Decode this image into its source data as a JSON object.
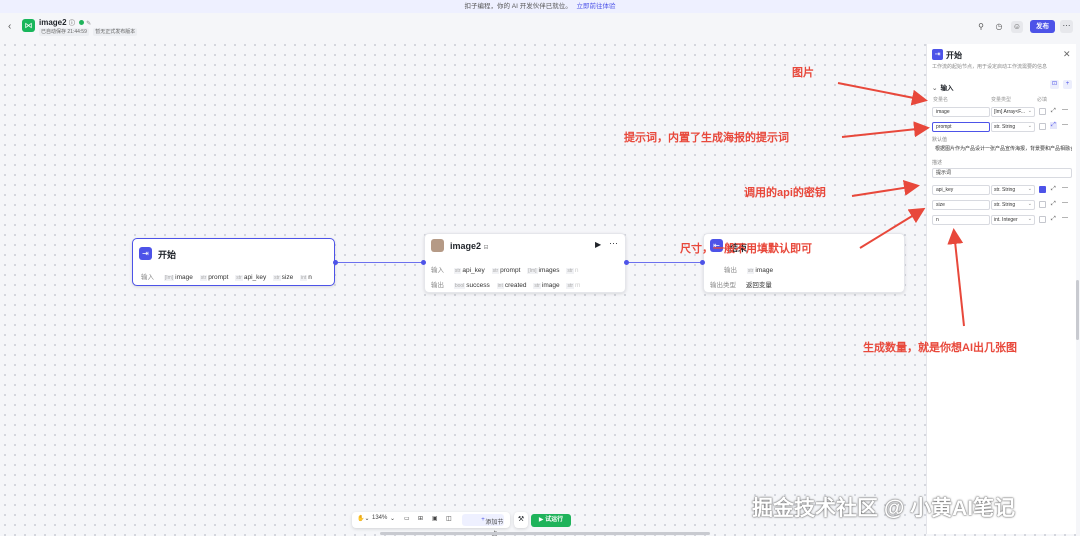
{
  "banner": {
    "text": "扣子编程，你的 AI 开发伙伴已就位。",
    "link": "立即前往体验"
  },
  "header": {
    "app_name": "image2",
    "meta_autosave": "已自动保存 21:44:59",
    "meta_publish": "暂无正式发布版本",
    "publish_label": "发布",
    "more_label": "···"
  },
  "nodes": {
    "start": {
      "title": "开始",
      "input_label": "输入",
      "params": [
        {
          "type": "[Im]",
          "name": "image"
        },
        {
          "type": "str",
          "name": "prompt"
        },
        {
          "type": "str",
          "name": "api_key"
        },
        {
          "type": "str",
          "name": "size"
        },
        {
          "type": "int",
          "name": "n"
        }
      ]
    },
    "image2": {
      "title": "image2",
      "input_label": "输入",
      "output_label": "输出",
      "inputs": [
        {
          "type": "str",
          "name": "api_key"
        },
        {
          "type": "str",
          "name": "prompt"
        },
        {
          "type": "[Im]",
          "name": "images"
        },
        {
          "type": "str",
          "name": "n"
        }
      ],
      "outputs": [
        {
          "type": "bool",
          "name": "success"
        },
        {
          "type": "int",
          "name": "created"
        },
        {
          "type": "str",
          "name": "image"
        },
        {
          "type": "str",
          "name": "m"
        }
      ]
    },
    "end": {
      "title": "结束",
      "output_label": "输出",
      "output_var": "image",
      "output_type_label": "输出类型",
      "output_type_value": "返回变量"
    }
  },
  "panel": {
    "title": "开始",
    "description": "工作流的起始节点，用于设定启动工作流需要的信息",
    "section": "输入",
    "col_name": "变量名",
    "col_type": "变量类型",
    "col_required": "必填",
    "vars": [
      {
        "name": "image",
        "type": "[Im] Array<F...",
        "required": false
      },
      {
        "name": "prompt",
        "type": "str. String",
        "required": false
      },
      {
        "name": "api_key",
        "type": "str. String",
        "required": true
      },
      {
        "name": "size",
        "type": "str. String",
        "required": false
      },
      {
        "name": "n",
        "type": "int. Integer",
        "required": false
      }
    ],
    "default_label": "默认值",
    "default_value": "根据图片作为产品设计一张产品宣传海报，背景要和产品相融合",
    "desc_label": "描述",
    "desc_value": "提示词"
  },
  "annotations": {
    "image": "图片",
    "prompt": "提示词，内置了生成海报的提示词",
    "api_key": "调用的api的密钥",
    "size": "尺寸，一般不用填默认即可",
    "n": "生成数量，就是你想AI出几张图"
  },
  "toolbar": {
    "zoom": "134%",
    "add_node": "添加节点",
    "run": "试运行"
  },
  "watermark": "掘金技术社区 @ 小黄AI笔记",
  "colors": {
    "accent": "#4d53e8",
    "success": "#1fb35b",
    "annotation": "#e8483b"
  }
}
